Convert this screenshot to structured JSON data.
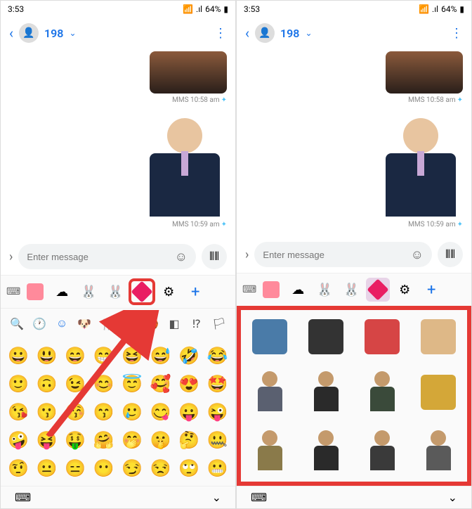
{
  "status": {
    "time": "3:53",
    "battery": "64%",
    "signal_icon": "📶",
    "wifi_icon": "📡"
  },
  "header": {
    "contact": "198",
    "back_icon": "‹",
    "more_icon": "⋮"
  },
  "messages": [
    {
      "type": "MMS",
      "time": "10:58 am"
    },
    {
      "type": "MMS",
      "time": "10:59 am"
    }
  ],
  "input": {
    "placeholder": "Enter message",
    "expand_icon": "›",
    "emoji_icon": "☺",
    "voice_icon": "⦀⦀"
  },
  "keyboard_tabs": {
    "keyboard_icon": "⌨",
    "settings_icon": "⚙",
    "add_icon": "+"
  },
  "emoji_categories": [
    "🔍",
    "🕐",
    "☺",
    "🐶",
    "🍴",
    "🏠",
    "🏀",
    "◧",
    "⁉",
    "🏳"
  ],
  "emoji_grid": [
    [
      "😀",
      "😃",
      "😄",
      "😁",
      "😆",
      "😅",
      "🤣",
      "😂"
    ],
    [
      "🙂",
      "🙃",
      "😉",
      "😊",
      "😇",
      "🥰",
      "😍",
      "🤩"
    ],
    [
      "😘",
      "😗",
      "😚",
      "😙",
      "🥲",
      "😋",
      "😛",
      "😜"
    ],
    [
      "🤪",
      "😝",
      "🤑",
      "🤗",
      "🤭",
      "🤫",
      "🤔",
      "🤐"
    ],
    [
      "🤨",
      "😐",
      "😑",
      "😶",
      "😏",
      "😒",
      "🙄",
      "😬"
    ]
  ],
  "sticker_items": [
    {
      "name": "glass-object",
      "color": "#4a7ba8"
    },
    {
      "name": "lamp",
      "color": "#333"
    },
    {
      "name": "red-tree",
      "color": "#d64545"
    },
    {
      "name": "hand-plate",
      "color": "#deb887"
    },
    {
      "name": "person-1",
      "type": "person",
      "shirt": "#5a6070"
    },
    {
      "name": "person-2",
      "type": "person",
      "shirt": "#2a2a2a"
    },
    {
      "name": "person-3",
      "type": "person",
      "shirt": "#3a4a3a"
    },
    {
      "name": "jar",
      "color": "#d4a738"
    },
    {
      "name": "person-4",
      "type": "person",
      "shirt": "#8a7a4a"
    },
    {
      "name": "person-5",
      "type": "person",
      "shirt": "#2a2a2a"
    },
    {
      "name": "person-6",
      "type": "person",
      "shirt": "#3a3a3a"
    },
    {
      "name": "person-7",
      "type": "person",
      "shirt": "#5a5a5a"
    }
  ],
  "bottom": {
    "keyboard_icon": "⌨",
    "collapse_icon": "⌄"
  }
}
